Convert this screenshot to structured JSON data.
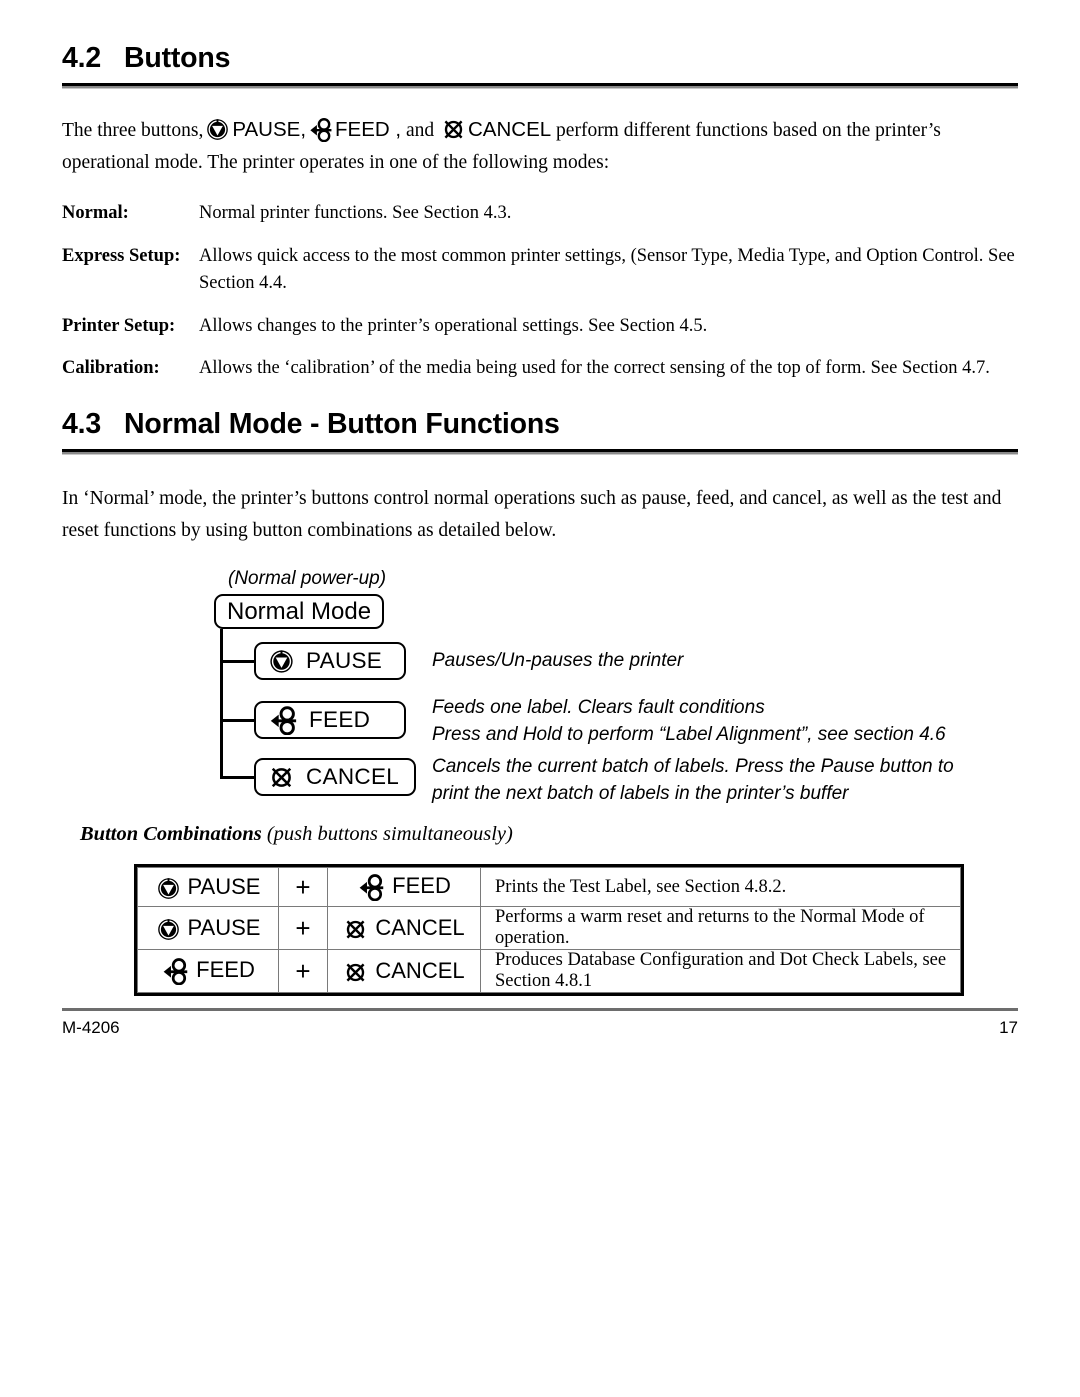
{
  "document": {
    "icons": {
      "pause": "pause-button-icon",
      "feed": "feed-button-icon",
      "cancel": "cancel-button-icon"
    },
    "sections": [
      {
        "number": "4.2",
        "title": "Buttons"
      },
      {
        "number": "4.3",
        "title": "Normal Mode - Button Functions"
      }
    ],
    "intro": {
      "p1_a": "The three buttons,",
      "p1_pause": "PAUSE,",
      "p1_feed": "FEED ,",
      "p1_and": "and",
      "p1_cancel": "CANCEL",
      "p1_b": "perform different functions based on the printer’s operational mode. The printer operates in one of the following modes:"
    },
    "modes": [
      {
        "term": "Normal:",
        "desc": "Normal printer functions. See Section 4.3."
      },
      {
        "term": "Express Setup:",
        "desc": "Allows quick access to the most common printer settings, (Sensor Type, Media Type, and Option Control. See Section 4.4."
      },
      {
        "term": "Printer Setup:",
        "desc": "Allows changes to the printer’s operational settings. See Section 4.5."
      },
      {
        "term": "Calibration:",
        "desc": "Allows the ‘calibration’ of the media being used for the correct sensing of the top of form. See Section 4.7."
      }
    ],
    "normal_mode_intro": "In ‘Normal’ mode, the printer’s buttons control normal operations such as pause, feed, and cancel, as well as the test and reset functions by using button combinations as detailed below.",
    "diagram": {
      "powerup_label": "(Normal power-up)",
      "root_label": "Normal Mode",
      "nodes": [
        {
          "label": "PAUSE",
          "icon": "pause-button-icon",
          "desc_line1": "Pauses/Un-pauses the printer",
          "desc_line2": ""
        },
        {
          "label": "FEED",
          "icon": "feed-button-icon",
          "desc_line1": "Feeds one label. Clears fault conditions",
          "desc_line2": "Press and Hold to perform “Label Alignment”, see section 4.6"
        },
        {
          "label": "CANCEL",
          "icon": "cancel-button-icon",
          "desc_line1": "Cancels the current batch of labels. Press the Pause button to",
          "desc_line2": "print the next batch of labels in the printer’s buffer"
        }
      ]
    },
    "combinations": {
      "title_bold": "Button Combinations",
      "title_italic": "(push buttons simultaneously)",
      "plus": "+",
      "rows": [
        {
          "button_a": "PAUSE",
          "icon_a": "pause-button-icon",
          "button_b": "FEED",
          "icon_b": "feed-button-icon",
          "description": "Prints the Test Label, see Section 4.8.2."
        },
        {
          "button_a": "PAUSE",
          "icon_a": "pause-button-icon",
          "button_b": "CANCEL",
          "icon_b": "cancel-button-icon",
          "description": "Performs a warm reset and returns to the Normal Mode of operation."
        },
        {
          "button_a": "FEED",
          "icon_a": "feed-button-icon",
          "button_b": "CANCEL",
          "icon_b": "cancel-button-icon",
          "description": "Produces Database Configuration and Dot Check Labels, see Section 4.8.1"
        }
      ]
    },
    "footer": {
      "left": "M-4206",
      "right": "17"
    }
  }
}
